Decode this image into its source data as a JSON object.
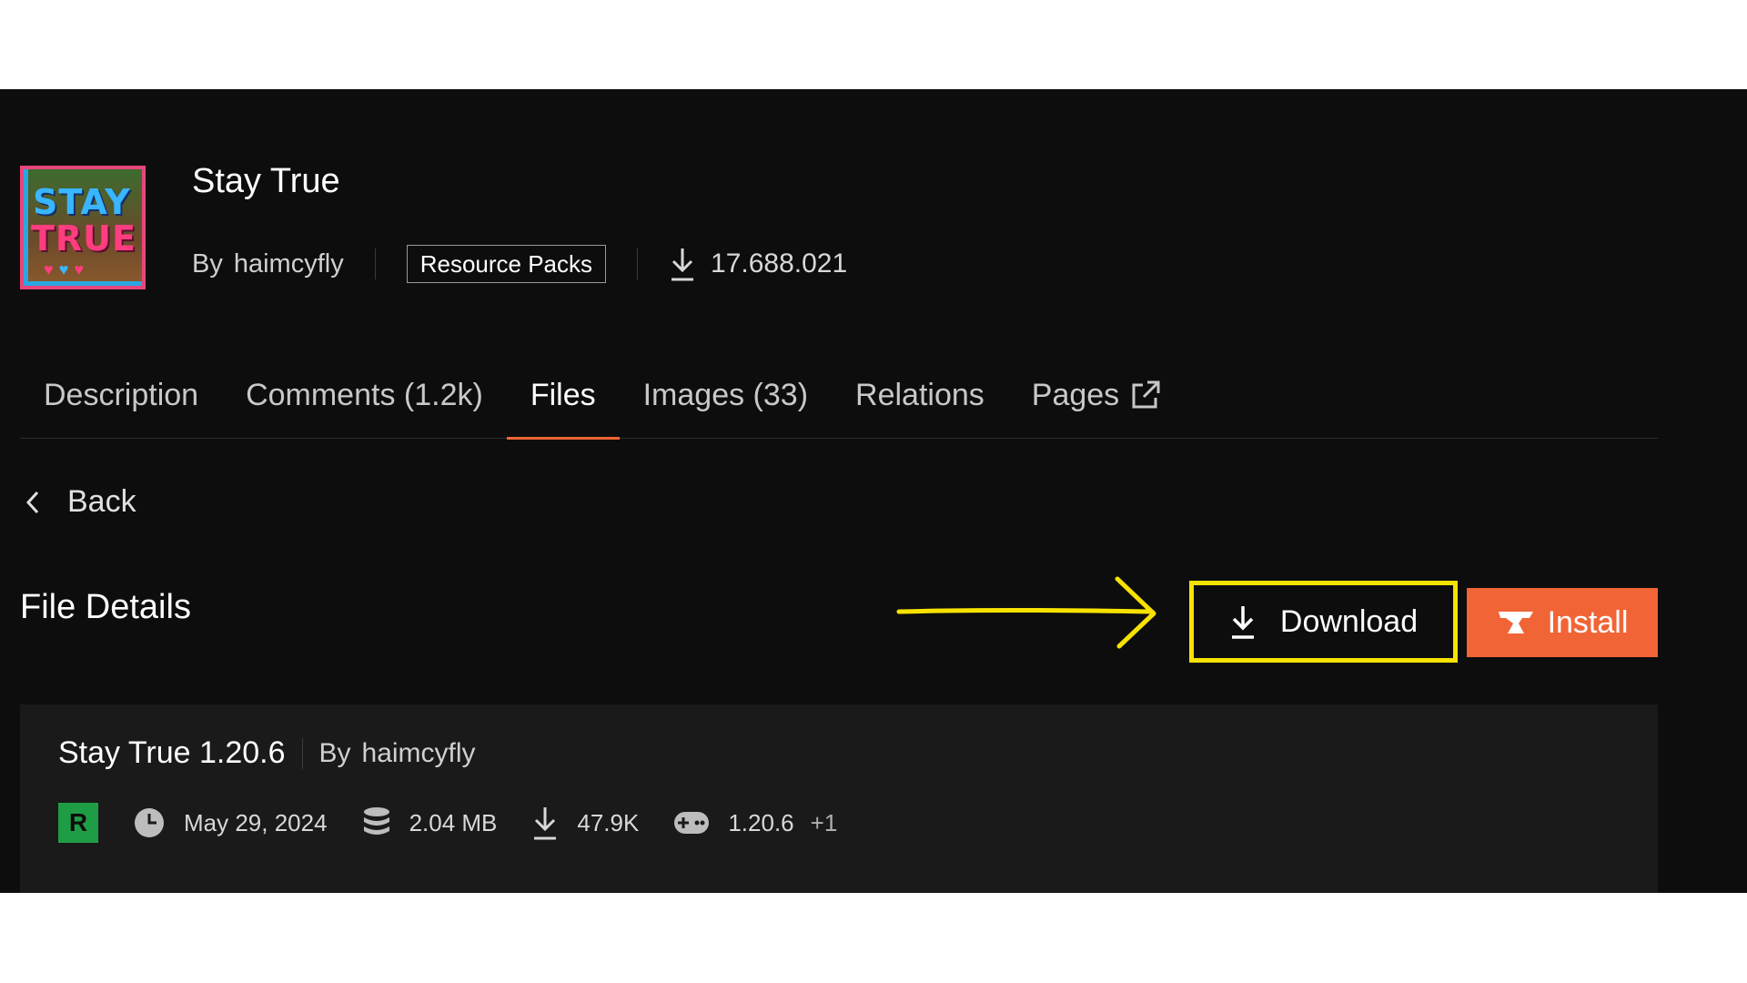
{
  "project": {
    "title": "Stay True",
    "logo_text_line1": "STAY",
    "logo_text_line2": "TRUE",
    "by_label": "By",
    "author": "haimcyfly",
    "category": "Resource Packs",
    "downloads": "17.688.021"
  },
  "tabs": [
    {
      "label": "Description",
      "active": false
    },
    {
      "label": "Comments (1.2k)",
      "active": false
    },
    {
      "label": "Files",
      "active": true
    },
    {
      "label": "Images (33)",
      "active": false
    },
    {
      "label": "Relations",
      "active": false
    },
    {
      "label": "Pages",
      "active": false,
      "icon": "external-link-icon"
    }
  ],
  "back_label": "Back",
  "section_title": "File Details",
  "actions": {
    "download_label": "Download",
    "install_label": "Install"
  },
  "file": {
    "name": "Stay True 1.20.6",
    "by_label": "By",
    "author": "haimcyfly",
    "release_type": "R",
    "date": "May 29, 2024",
    "size": "2.04 MB",
    "downloads": "47.9K",
    "game_version": "1.20.6",
    "more_versions": "+1"
  },
  "colors": {
    "page_bg": "#0d0d0d",
    "accent": "#f16436",
    "annotation": "#f7e200",
    "release_green": "#1f9d46"
  }
}
